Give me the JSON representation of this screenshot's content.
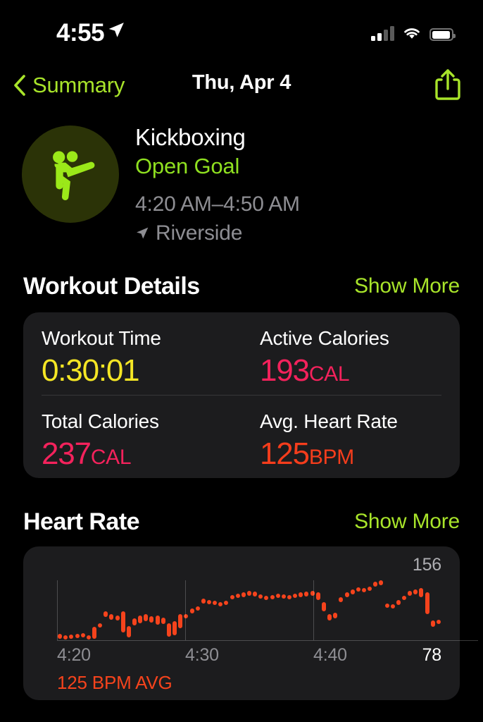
{
  "status_bar": {
    "time": "4:55",
    "location_icon": "location-arrow-icon",
    "cellular_icon": "cellular-signal-icon",
    "wifi_icon": "wifi-icon",
    "battery_icon": "battery-full-icon"
  },
  "nav": {
    "back_label": "Summary",
    "back_icon": "chevron-left-icon",
    "title": "Thu, Apr 4",
    "share_icon": "share-icon"
  },
  "workout": {
    "icon": "kickboxing-icon",
    "title": "Kickboxing",
    "goal": "Open Goal",
    "time_range": "4:20 AM–4:50 AM",
    "location_icon": "location-arrow-icon",
    "location": "Riverside"
  },
  "details_section": {
    "title": "Workout Details",
    "show_more": "Show More",
    "metrics": [
      {
        "label": "Workout Time",
        "value": "0:30:01",
        "unit": "",
        "color": "#F5E625"
      },
      {
        "label": "Active Calories",
        "value": "193",
        "unit": "CAL",
        "color": "#F4225C"
      },
      {
        "label": "Total Calories",
        "value": "237",
        "unit": "CAL",
        "color": "#F4225C"
      },
      {
        "label": "Avg. Heart Rate",
        "value": "125",
        "unit": "BPM",
        "color": "#F53D1C"
      }
    ]
  },
  "heart_rate_section": {
    "title": "Heart Rate",
    "show_more": "Show More",
    "max_label": "156",
    "min_label": "78",
    "avg_label": "125 BPM AVG",
    "x_ticks": [
      "4:20",
      "4:30",
      "4:40"
    ]
  },
  "chart_data": {
    "type": "bar",
    "title": "Heart Rate",
    "xlabel": "",
    "ylabel": "BPM",
    "ylim": [
      78,
      156
    ],
    "xlim": [
      "4:20",
      "4:50"
    ],
    "grid": false,
    "legend": null,
    "annotations": [
      "156",
      "78",
      "125 BPM AVG"
    ],
    "x_ticks": [
      "4:20",
      "4:30",
      "4:40"
    ],
    "series": [
      {
        "name": "Heart Rate range (BPM)",
        "color": "#F5431C",
        "ranges": [
          [
            80,
            86
          ],
          [
            80,
            84
          ],
          [
            81,
            85
          ],
          [
            82,
            86
          ],
          [
            83,
            87
          ],
          [
            79,
            84
          ],
          [
            80,
            95
          ],
          [
            96,
            100
          ],
          [
            108,
            116
          ],
          [
            105,
            112
          ],
          [
            104,
            110
          ],
          [
            88,
            116
          ],
          [
            82,
            96
          ],
          [
            97,
            106
          ],
          [
            100,
            110
          ],
          [
            103,
            112
          ],
          [
            101,
            109
          ],
          [
            98,
            110
          ],
          [
            99,
            107
          ],
          [
            83,
            100
          ],
          [
            84,
            103
          ],
          [
            94,
            112
          ],
          [
            106,
            112
          ],
          [
            113,
            119
          ],
          [
            117,
            122
          ],
          [
            126,
            132
          ],
          [
            125,
            130
          ],
          [
            124,
            129
          ],
          [
            123,
            128
          ],
          [
            124,
            129
          ],
          [
            131,
            137
          ],
          [
            133,
            139
          ],
          [
            134,
            140
          ],
          [
            136,
            142
          ],
          [
            135,
            141
          ],
          [
            132,
            138
          ],
          [
            130,
            136
          ],
          [
            131,
            137
          ],
          [
            133,
            139
          ],
          [
            132,
            138
          ],
          [
            131,
            137
          ],
          [
            133,
            139
          ],
          [
            134,
            140
          ],
          [
            135,
            141
          ],
          [
            136,
            142
          ],
          [
            130,
            140
          ],
          [
            116,
            128
          ],
          [
            104,
            112
          ],
          [
            106,
            114
          ],
          [
            128,
            134
          ],
          [
            134,
            140
          ],
          [
            138,
            144
          ],
          [
            141,
            147
          ],
          [
            140,
            146
          ],
          [
            142,
            148
          ],
          [
            148,
            154
          ],
          [
            150,
            156
          ],
          [
            120,
            126
          ],
          [
            119,
            125
          ],
          [
            124,
            130
          ],
          [
            130,
            136
          ],
          [
            136,
            142
          ],
          [
            138,
            144
          ],
          [
            134,
            146
          ],
          [
            112,
            140
          ],
          [
            95,
            104
          ],
          [
            99,
            105
          ]
        ]
      }
    ]
  }
}
